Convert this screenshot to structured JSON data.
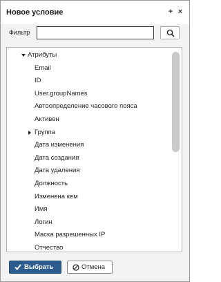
{
  "dialog": {
    "title": "Новое условие",
    "pin_icon": "+",
    "close_icon": "×"
  },
  "filter": {
    "label": "Фильтр",
    "value": "",
    "placeholder": "",
    "search_icon": "search-icon"
  },
  "tree": {
    "items": [
      {
        "label": "Атрибуты",
        "level": 0,
        "toggle": "expanded"
      },
      {
        "label": "Email",
        "level": 1,
        "toggle": "none"
      },
      {
        "label": "ID",
        "level": 1,
        "toggle": "none"
      },
      {
        "label": "User.groupNames",
        "level": 1,
        "toggle": "none"
      },
      {
        "label": "Автоопределение часового пояса",
        "level": 1,
        "toggle": "none"
      },
      {
        "label": "Активен",
        "level": 1,
        "toggle": "none"
      },
      {
        "label": "Группа",
        "level": 1,
        "toggle": "collapsed"
      },
      {
        "label": "Дата изменения",
        "level": 1,
        "toggle": "none"
      },
      {
        "label": "Дата создания",
        "level": 1,
        "toggle": "none"
      },
      {
        "label": "Дата удаления",
        "level": 1,
        "toggle": "none"
      },
      {
        "label": "Должность",
        "level": 1,
        "toggle": "none"
      },
      {
        "label": "Изменена кем",
        "level": 1,
        "toggle": "none"
      },
      {
        "label": "Имя",
        "level": 1,
        "toggle": "none"
      },
      {
        "label": "Логин",
        "level": 1,
        "toggle": "none"
      },
      {
        "label": "Маска разрешенных IP",
        "level": 1,
        "toggle": "none"
      },
      {
        "label": "Отчество",
        "level": 1,
        "toggle": "none"
      }
    ]
  },
  "footer": {
    "select_label": "Выбрать",
    "cancel_label": "Отмена"
  },
  "colors": {
    "primary_button": "#2d5d8e",
    "scrollbar_thumb": "#c9c9c9"
  }
}
